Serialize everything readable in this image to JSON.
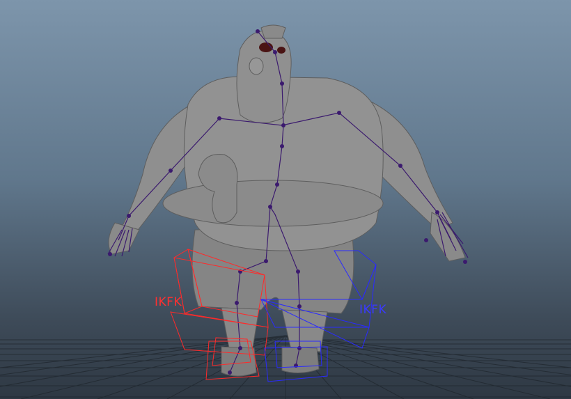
{
  "viewport": {
    "ik_fk_switch_left": {
      "label": "IKFK",
      "color": "#ff2a2a"
    },
    "ik_fk_switch_right": {
      "label": "IKFK",
      "color": "#2a2aff"
    }
  },
  "colors": {
    "background_top": "#7d95ab",
    "background_bottom": "#2e3843",
    "grid": "#1f262d",
    "model": "#8e8e8e",
    "skeleton": "#3b1a6e",
    "left_foot_control": "#ff2a2a",
    "right_foot_control": "#2a2aff"
  }
}
